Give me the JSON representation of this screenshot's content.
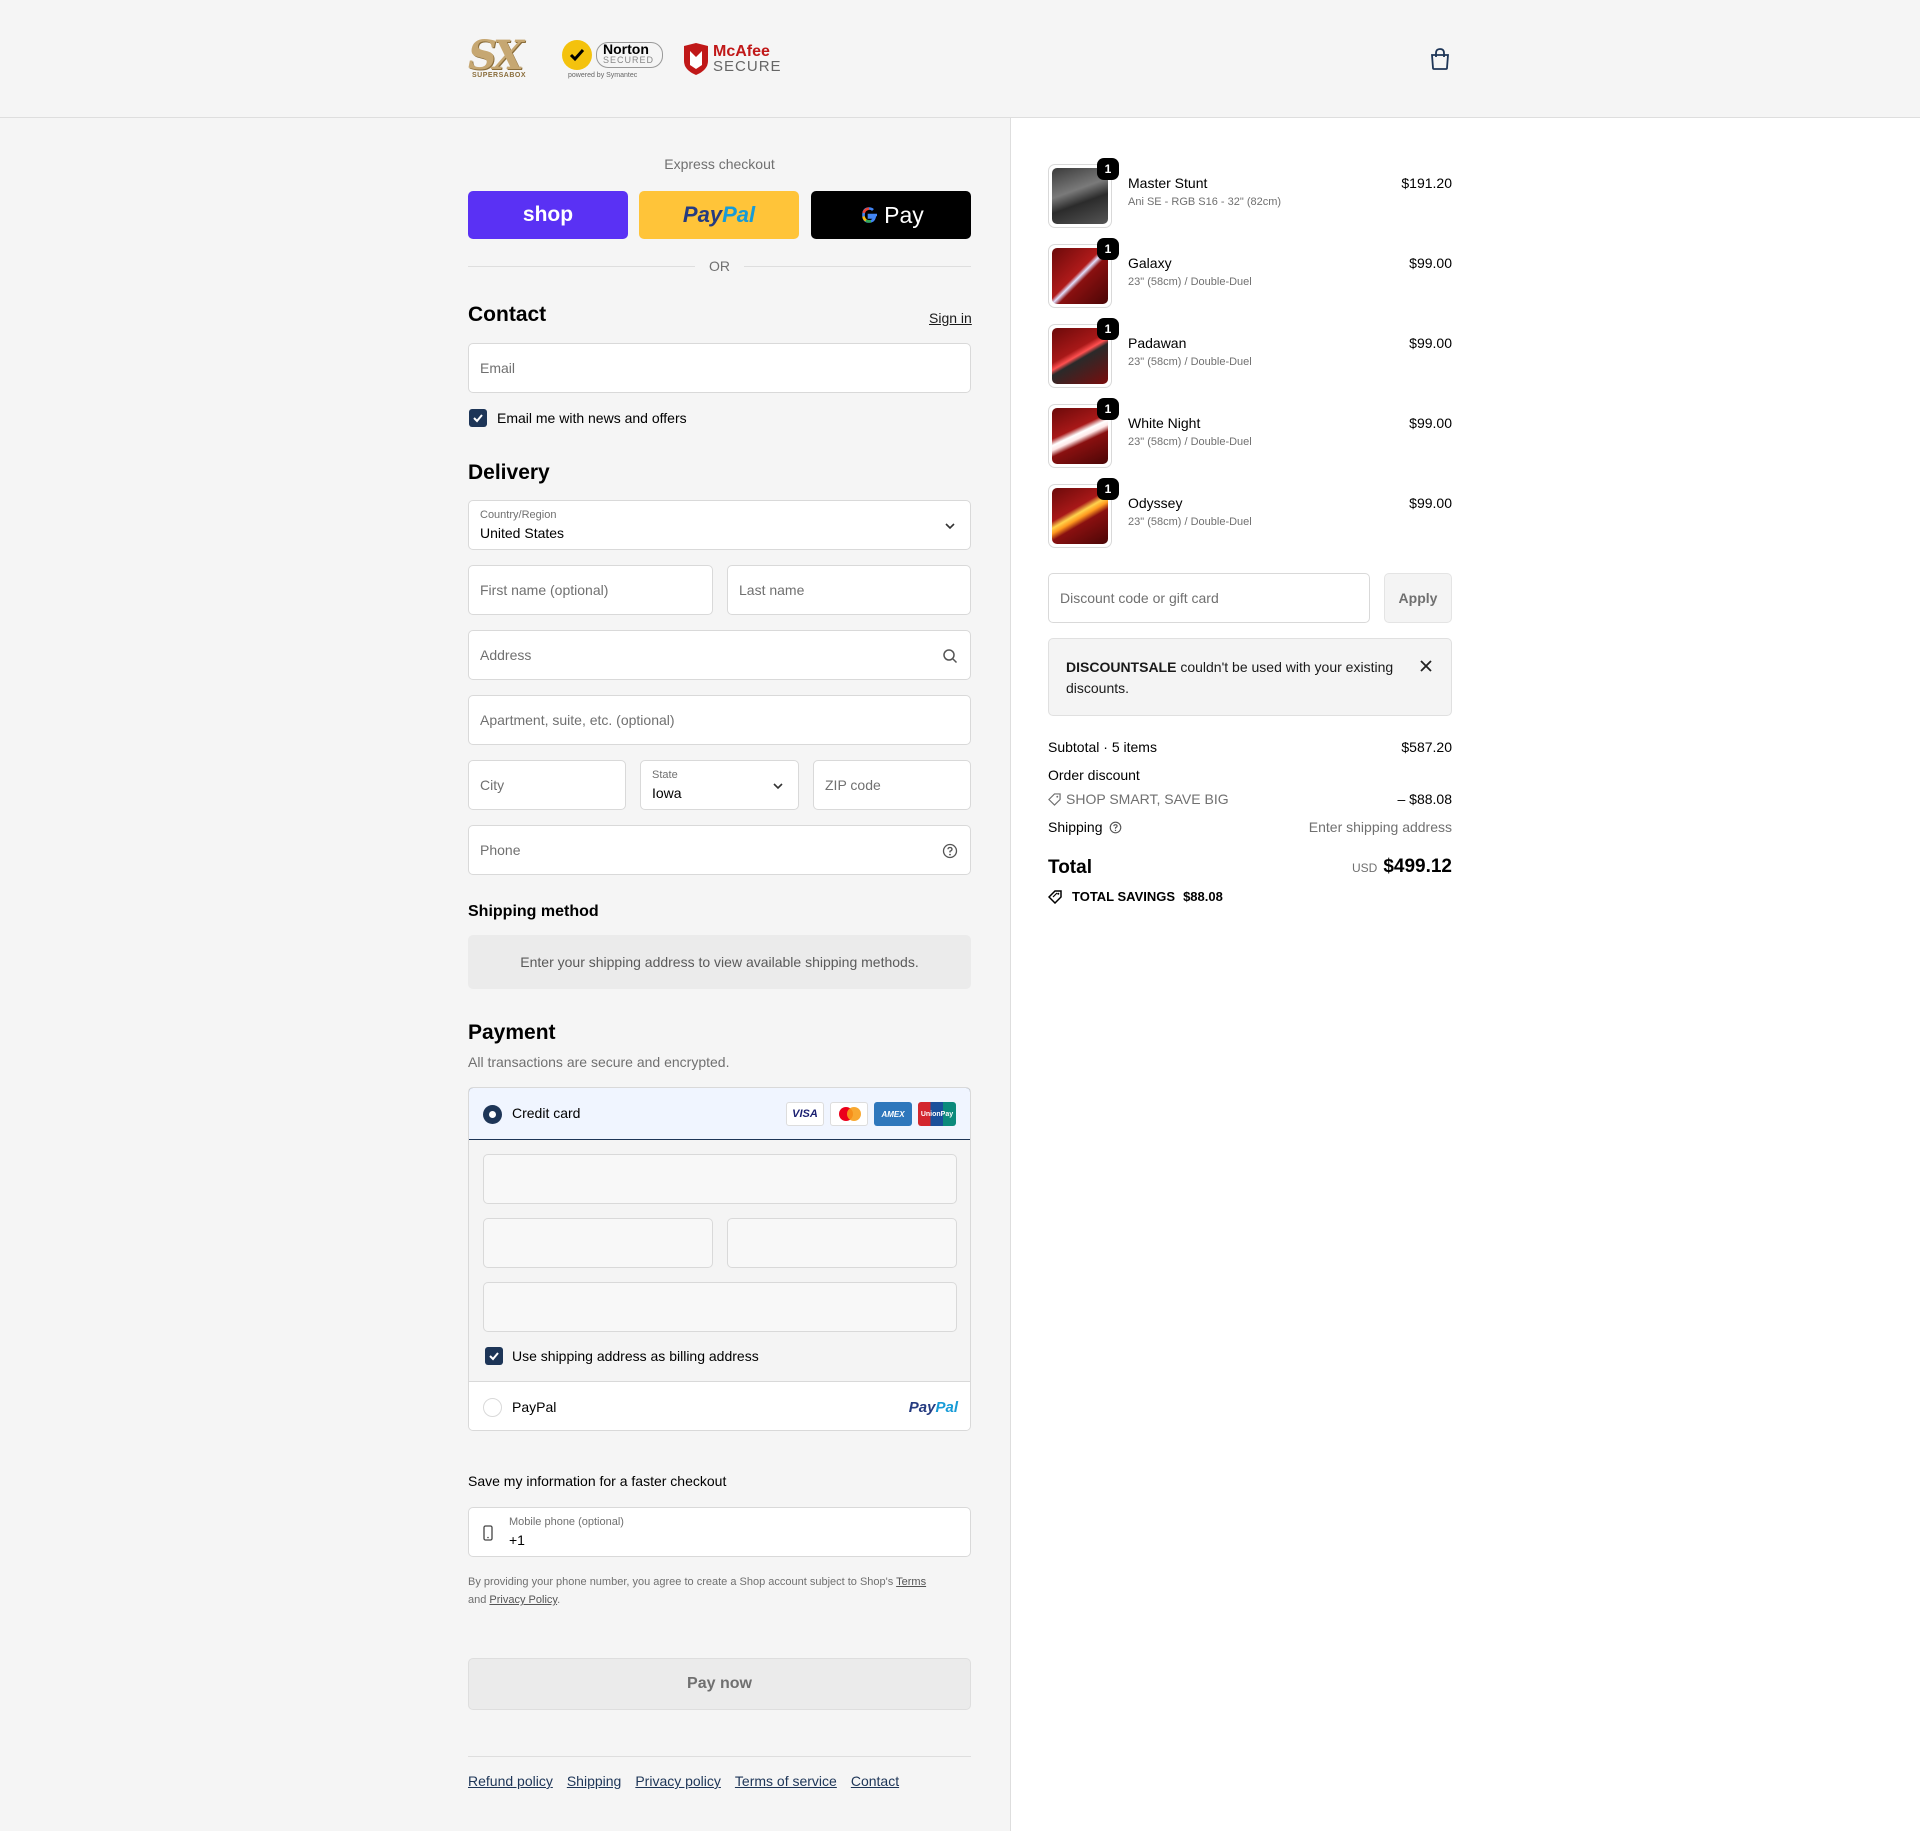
{
  "header": {
    "logo_sx_big": "SX",
    "logo_sx_small": "SUPERSABOX",
    "norton_name": "Norton",
    "norton_secured": "SECURED",
    "norton_by": "powered by Symantec",
    "mcafee_name": "McAfee",
    "mcafee_secure": "SECURE",
    "cart_icon": "shopping-bag-icon"
  },
  "express": {
    "title": "Express checkout",
    "shop_label": "shop",
    "paypal_dark": "Pay",
    "paypal_light": "Pal",
    "gpay_g": "G",
    "gpay_label": "Pay",
    "or": "OR"
  },
  "contact": {
    "title": "Contact",
    "sign_in": "Sign in",
    "email_placeholder": "Email",
    "news_label": "Email me with news and offers",
    "news_checked": true
  },
  "delivery": {
    "title": "Delivery",
    "country_label": "Country/Region",
    "country_value": "United States",
    "first_name_placeholder": "First name (optional)",
    "last_name_placeholder": "Last name",
    "address_placeholder": "Address",
    "apartment_placeholder": "Apartment, suite, etc. (optional)",
    "city_placeholder": "City",
    "state_label": "State",
    "state_value": "Iowa",
    "zip_placeholder": "ZIP code",
    "phone_placeholder": "Phone"
  },
  "shipping_method": {
    "title": "Shipping method",
    "message": "Enter your shipping address to view available shipping methods."
  },
  "payment": {
    "title": "Payment",
    "subtitle": "All transactions are secure and encrypted.",
    "credit_card_label": "Credit card",
    "cards": [
      "VISA",
      "AMEX",
      "UnionPay"
    ],
    "billing_label": "Use shipping address as billing address",
    "billing_checked": true,
    "paypal_label": "PayPal",
    "paypal_logo_dark": "Pay",
    "paypal_logo_light": "Pal"
  },
  "save_info": {
    "title": "Save my information for a faster checkout",
    "mobile_label": "Mobile phone (optional)",
    "mobile_value": "+1",
    "fine_print_1": "By providing your phone number, you agree to create a Shop account subject to Shop's",
    "terms": "Terms",
    "and": "and",
    "privacy": "Privacy Policy",
    "period": "."
  },
  "pay_now": "Pay now",
  "footer_links": [
    "Refund policy",
    "Shipping",
    "Privacy policy",
    "Terms of service",
    "Contact"
  ],
  "cart": {
    "items": [
      {
        "name": "Master Stunt",
        "variant": "Ani SE - RGB S16 - 32\" (82cm)",
        "price": "$191.20",
        "qty": "1"
      },
      {
        "name": "Galaxy",
        "variant": "23\" (58cm) / Double-Duel",
        "price": "$99.00",
        "qty": "1"
      },
      {
        "name": "Padawan",
        "variant": "23\" (58cm) / Double-Duel",
        "price": "$99.00",
        "qty": "1"
      },
      {
        "name": "White Night",
        "variant": "23\" (58cm) / Double-Duel",
        "price": "$99.00",
        "qty": "1"
      },
      {
        "name": "Odyssey",
        "variant": "23\" (58cm) / Double-Duel",
        "price": "$99.00",
        "qty": "1"
      }
    ],
    "discount_placeholder": "Discount code or gift card",
    "apply": "Apply",
    "notice_code": "DISCOUNTSALE",
    "notice_text": " couldn't be used with your existing discounts."
  },
  "summary": {
    "subtotal_label": "Subtotal · 5 items",
    "subtotal_value": "$587.20",
    "order_discount_label": "Order discount",
    "discount_name": "SHOP SMART, SAVE BIG",
    "discount_value": "– $88.08",
    "shipping_label": "Shipping",
    "shipping_value": "Enter shipping address",
    "total_label": "Total",
    "currency": "USD",
    "total_value": "$499.12",
    "savings_label": "TOTAL SAVINGS",
    "savings_value": "$88.08"
  },
  "colors": {
    "shop": "#5a31f4",
    "paypal": "#ffc439",
    "accent": "#1d3557"
  }
}
